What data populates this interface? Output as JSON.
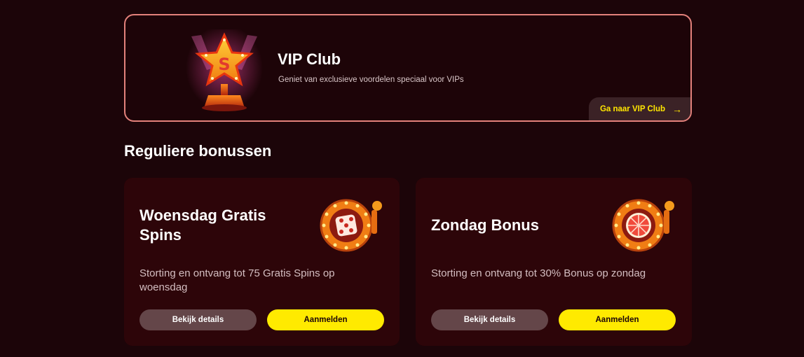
{
  "vip": {
    "title": "VIP Club",
    "subtitle": "Geniet van exclusieve voordelen speciaal voor VIPs",
    "link_label": "Ga naar VIP Club",
    "link_icon": "arrow-right-icon",
    "art_icon": "star-trophy-icon"
  },
  "section": {
    "title": "Reguliere bonussen"
  },
  "bonuses": [
    {
      "title": "Woensdag Gratis Spins",
      "description": "Storting en ontvang tot 75 Gratis Spins op woensdag",
      "details_label": "Bekijk details",
      "join_label": "Aanmelden",
      "icon": "dice-slot-wheel-icon"
    },
    {
      "title": "Zondag Bonus",
      "description": "Storting en ontvang tot 30% Bonus op zondag",
      "details_label": "Bekijk details",
      "join_label": "Aanmelden",
      "icon": "grapefruit-slot-wheel-icon"
    }
  ],
  "colors": {
    "background": "#1c0509",
    "card": "#2d0509",
    "accent_yellow": "#ffea00",
    "vip_border": "#e3817b",
    "secondary_button": "#644649"
  }
}
